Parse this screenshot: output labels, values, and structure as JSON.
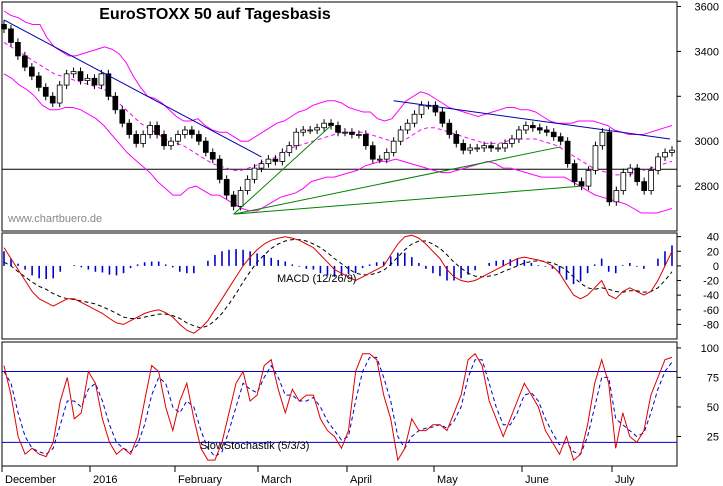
{
  "chart_data": {
    "type": "line",
    "title": "EuroSTOXX 50 auf Tagesbasis",
    "watermark": "www.chartbuero.de",
    "x_months": [
      "December",
      "2016",
      "February",
      "March",
      "April",
      "May",
      "June",
      "July"
    ],
    "colors": {
      "candle_body": "#ffffff",
      "candle_edge": "#000000",
      "bollinger": "#ff00ff",
      "trend_down": "#0000aa",
      "fan": "#008000",
      "macd_line": "#dd0000",
      "signal_line": "#000000",
      "hist": "#0000cc",
      "stoch_k": "#dd0000",
      "stoch_d": "#0000cc",
      "ref_line": "#000000",
      "stoch_band": "#0000cc"
    },
    "price": {
      "ylim": [
        2600,
        3620
      ],
      "yticks": [
        2800,
        3000,
        3200,
        3400,
        3600
      ],
      "ytick_labels": [
        "2800",
        "3000",
        "3200",
        "3400",
        "3600"
      ],
      "reference_line": 2875,
      "series": [
        {
          "name": "close",
          "values": [
            3500,
            3440,
            3380,
            3330,
            3290,
            3240,
            3200,
            3170,
            3250,
            3300,
            3310,
            3270,
            3280,
            3250,
            3300,
            3200,
            3140,
            3080,
            3030,
            2990,
            3030,
            3070,
            3030,
            2980,
            3000,
            3030,
            3050,
            3030,
            3000,
            2950,
            2920,
            2830,
            2760,
            2710,
            2780,
            2830,
            2880,
            2900,
            2920,
            2910,
            2950,
            2980,
            3040,
            3050,
            3050,
            3060,
            3080,
            3070,
            3040,
            3040,
            3030,
            3030,
            2980,
            2920,
            2920,
            2950,
            3000,
            3050,
            3080,
            3120,
            3160,
            3160,
            3130,
            3080,
            3030,
            2990,
            2960,
            2970,
            2970,
            2980,
            2970,
            2970,
            2990,
            3010,
            3050,
            3070,
            3060,
            3050,
            3040,
            3020,
            3000,
            2900,
            2820,
            2800,
            2870,
            2980,
            3040,
            2730,
            2780,
            2860,
            2880,
            2820,
            2780,
            2870,
            2930,
            2950,
            2960
          ]
        },
        {
          "name": "bollinger_upper",
          "values": [
            3580,
            3560,
            3550,
            3530,
            3520,
            3520,
            3460,
            3420,
            3400,
            3380,
            3380,
            3390,
            3400,
            3410,
            3420,
            3410,
            3390,
            3350,
            3290,
            3240,
            3200,
            3190,
            3170,
            3140,
            3110,
            3090,
            3090,
            3100,
            3070,
            3050,
            3040,
            3040,
            3020,
            3000,
            3000,
            3020,
            3040,
            3060,
            3080,
            3090,
            3110,
            3130,
            3140,
            3160,
            3170,
            3180,
            3180,
            3170,
            3150,
            3140,
            3130,
            3130,
            3100,
            3090,
            3100,
            3140,
            3180,
            3200,
            3220,
            3210,
            3190,
            3170,
            3150,
            3140,
            3130,
            3120,
            3110,
            3120,
            3130,
            3140,
            3150,
            3150,
            3140,
            3140,
            3130,
            3110,
            3090,
            3080,
            3080,
            3080,
            3090,
            3090,
            3090,
            3080,
            3070,
            3050,
            3040,
            3030,
            3030,
            3030,
            3040,
            3050,
            3060,
            3070
          ]
        },
        {
          "name": "bollinger_middle",
          "values": [
            3440,
            3420,
            3400,
            3380,
            3360,
            3340,
            3320,
            3300,
            3290,
            3280,
            3270,
            3260,
            3250,
            3240,
            3230,
            3200,
            3170,
            3140,
            3110,
            3080,
            3060,
            3040,
            3020,
            3000,
            2990,
            2980,
            2960,
            2940,
            2920,
            2900,
            2890,
            2880,
            2870,
            2870,
            2880,
            2890,
            2910,
            2920,
            2930,
            2950,
            2970,
            2980,
            2990,
            3000,
            3010,
            3020,
            3030,
            3040,
            3040,
            3040,
            3040,
            3030,
            3020,
            3010,
            3000,
            3000,
            3010,
            3030,
            3050,
            3060,
            3060,
            3050,
            3040,
            3030,
            3020,
            3010,
            3000,
            2990,
            2990,
            2990,
            3000,
            3010,
            3010,
            3010,
            3010,
            3000,
            2990,
            2980,
            2960,
            2940,
            2920,
            2900,
            2880,
            2870,
            2860,
            2850,
            2850,
            2850,
            2860,
            2870,
            2880,
            2890,
            2900,
            2910
          ]
        },
        {
          "name": "bollinger_lower",
          "values": [
            3300,
            3280,
            3250,
            3230,
            3200,
            3160,
            3140,
            3140,
            3150,
            3150,
            3140,
            3120,
            3100,
            3070,
            3030,
            2990,
            2950,
            2920,
            2890,
            2860,
            2820,
            2790,
            2760,
            2760,
            2790,
            2800,
            2780,
            2760,
            2760,
            2740,
            2720,
            2700,
            2690,
            2690,
            2710,
            2730,
            2750,
            2760,
            2770,
            2790,
            2820,
            2830,
            2840,
            2840,
            2850,
            2860,
            2870,
            2890,
            2900,
            2910,
            2910,
            2920,
            2910,
            2900,
            2890,
            2880,
            2870,
            2860,
            2860,
            2870,
            2880,
            2890,
            2900,
            2910,
            2900,
            2880,
            2880,
            2870,
            2860,
            2850,
            2840,
            2840,
            2840,
            2840,
            2820,
            2800,
            2780,
            2760,
            2750,
            2740,
            2730,
            2720,
            2700,
            2680,
            2680,
            2680,
            2690,
            2700
          ]
        }
      ]
    },
    "macd": {
      "label": "MACD (12/26/9)",
      "ylim": [
        -100,
        45
      ],
      "yticks": [
        40,
        20,
        0,
        -20,
        -40,
        -60,
        -80
      ],
      "ytick_labels": [
        "40",
        "20",
        "0",
        "-20",
        "-40",
        "-60",
        "-80"
      ],
      "series": [
        {
          "name": "macd",
          "values": [
            25,
            10,
            -5,
            -20,
            -35,
            -45,
            -50,
            -55,
            -50,
            -45,
            -45,
            -50,
            -55,
            -60,
            -65,
            -72,
            -78,
            -80,
            -75,
            -70,
            -65,
            -62,
            -60,
            -64,
            -70,
            -80,
            -88,
            -92,
            -85,
            -75,
            -60,
            -45,
            -30,
            -15,
            0,
            12,
            22,
            30,
            35,
            38,
            40,
            38,
            35,
            30,
            25,
            15,
            5,
            -5,
            -10,
            -15,
            -20,
            -15,
            -10,
            -5,
            0,
            15,
            30,
            40,
            42,
            38,
            30,
            20,
            10,
            -5,
            -15,
            -20,
            -22,
            -20,
            -15,
            -10,
            -5,
            0,
            5,
            10,
            12,
            10,
            8,
            5,
            0,
            -10,
            -25,
            -40,
            -45,
            -40,
            -30,
            -20,
            -40,
            -45,
            -35,
            -30,
            -35,
            -40,
            -35,
            -20,
            0,
            20
          ]
        },
        {
          "name": "signal",
          "values": [
            5,
            0,
            -8,
            -15,
            -22,
            -28,
            -32,
            -38,
            -42,
            -45,
            -46,
            -48,
            -50,
            -52,
            -56,
            -60,
            -65,
            -70,
            -72,
            -72,
            -70,
            -68,
            -66,
            -66,
            -68,
            -72,
            -78,
            -82,
            -85,
            -82,
            -75,
            -65,
            -52,
            -38,
            -22,
            -8,
            5,
            15,
            24,
            30,
            34,
            36,
            36,
            34,
            30,
            25,
            18,
            10,
            3,
            -4,
            -10,
            -12,
            -12,
            -10,
            -6,
            2,
            12,
            22,
            30,
            34,
            34,
            30,
            24,
            15,
            5,
            -3,
            -10,
            -14,
            -15,
            -14,
            -12,
            -8,
            -4,
            0,
            4,
            6,
            7,
            6,
            4,
            0,
            -6,
            -15,
            -24,
            -30,
            -32,
            -30,
            -32,
            -35,
            -36,
            -34,
            -34,
            -36,
            -35,
            -30,
            -20,
            -8
          ]
        },
        {
          "name": "histogram",
          "values": [
            20,
            10,
            3,
            -5,
            -13,
            -17,
            -18,
            -17,
            -8,
            0,
            1,
            -2,
            -5,
            -8,
            -9,
            -12,
            -13,
            -10,
            -3,
            2,
            5,
            6,
            6,
            2,
            -2,
            -8,
            -10,
            -10,
            0,
            7,
            15,
            20,
            22,
            23,
            22,
            20,
            17,
            15,
            11,
            8,
            6,
            2,
            -1,
            -4,
            -5,
            -10,
            -13,
            -15,
            -13,
            -11,
            -10,
            -3,
            2,
            5,
            6,
            13,
            18,
            18,
            12,
            4,
            -4,
            -10,
            -14,
            -20,
            -20,
            -17,
            -12,
            -6,
            0,
            4,
            7,
            8,
            9,
            10,
            8,
            4,
            1,
            -1,
            -4,
            -10,
            -19,
            -25,
            -21,
            -10,
            2,
            10,
            -8,
            -10,
            1,
            4,
            -1,
            -4,
            0,
            10,
            20,
            28
          ]
        }
      ]
    },
    "stochastic": {
      "label": "SlowStochastik (5/3/3)",
      "ylim": [
        0,
        105
      ],
      "yticks": [
        100,
        75,
        50,
        25
      ],
      "ytick_labels": [
        "100",
        "75",
        "50",
        "25"
      ],
      "bands": [
        80,
        20
      ],
      "series": [
        {
          "name": "%K",
          "values": [
            85,
            60,
            25,
            10,
            15,
            10,
            8,
            20,
            55,
            75,
            40,
            45,
            80,
            70,
            40,
            20,
            10,
            15,
            10,
            25,
            55,
            85,
            80,
            50,
            30,
            55,
            70,
            40,
            15,
            5,
            5,
            20,
            45,
            70,
            80,
            55,
            60,
            85,
            90,
            65,
            45,
            65,
            55,
            60,
            60,
            40,
            30,
            25,
            15,
            30,
            80,
            95,
            95,
            90,
            60,
            40,
            5,
            15,
            40,
            30,
            30,
            35,
            35,
            30,
            45,
            60,
            90,
            95,
            85,
            55,
            40,
            25,
            40,
            55,
            70,
            60,
            50,
            30,
            20,
            10,
            25,
            5,
            10,
            35,
            70,
            90,
            70,
            15,
            45,
            25,
            20,
            30,
            60,
            75,
            90,
            92
          ]
        },
        {
          "name": "%D",
          "values": [
            80,
            70,
            45,
            25,
            15,
            12,
            10,
            15,
            35,
            55,
            55,
            50,
            65,
            70,
            55,
            35,
            20,
            15,
            12,
            18,
            35,
            60,
            75,
            70,
            50,
            45,
            55,
            50,
            30,
            15,
            8,
            12,
            30,
            50,
            70,
            65,
            62,
            75,
            85,
            75,
            60,
            60,
            55,
            55,
            58,
            50,
            38,
            30,
            22,
            25,
            55,
            80,
            92,
            92,
            75,
            55,
            25,
            15,
            25,
            30,
            32,
            33,
            35,
            32,
            38,
            50,
            75,
            90,
            90,
            70,
            50,
            35,
            35,
            45,
            60,
            62,
            55,
            40,
            28,
            18,
            20,
            12,
            10,
            25,
            50,
            75,
            75,
            40,
            35,
            30,
            25,
            28,
            45,
            65,
            80,
            88
          ]
        }
      ]
    }
  }
}
